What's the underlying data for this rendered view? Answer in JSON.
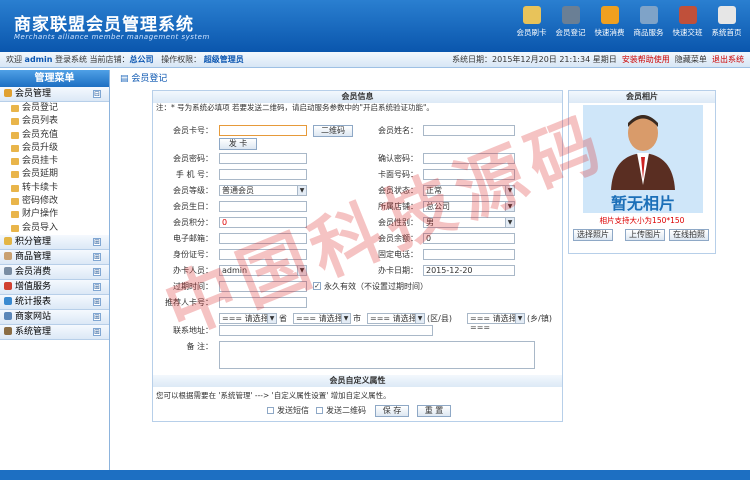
{
  "app": {
    "title": "商家联盟会员管理系统",
    "subtitle": "Merchants alliance member management system"
  },
  "topnav": [
    {
      "label": "会员刷卡",
      "icon": "card-icon",
      "color": "#e8c35a"
    },
    {
      "label": "会员登记",
      "icon": "user-icon",
      "color": "#6a7f95"
    },
    {
      "label": "快速消费",
      "icon": "cart-icon",
      "color": "#f0a020"
    },
    {
      "label": "商品服务",
      "icon": "doc-icon",
      "color": "#7fa3c8"
    },
    {
      "label": "快速交班",
      "icon": "users-icon",
      "color": "#c0503a"
    },
    {
      "label": "系统首页",
      "icon": "home-icon",
      "color": "#e6e6e6"
    }
  ],
  "infobar": {
    "welcome": "欢迎",
    "user": "admin",
    "login_sys": "登录系统",
    "store_label": "当前店铺：",
    "store": "总公司",
    "perm_label": "操作权限：",
    "perm": "超级管理员",
    "date": "系统日期：2015年12月20日 21:1:34 星期日",
    "links": [
      "安装帮助使用",
      "隐藏菜单",
      "退出系统"
    ]
  },
  "sidebar": {
    "title": "管理菜单",
    "groups": [
      {
        "label": "会员管理",
        "toggle": "⊟",
        "color": "#e0a030",
        "items": [
          "会员登记",
          "会员列表",
          "会员充值",
          "会员升级",
          "会员挂卡",
          "会员延期",
          "转卡续卡",
          "密码修改",
          "财户操作",
          "会员导入"
        ]
      },
      {
        "label": "积分管理",
        "toggle": "⊞",
        "color": "#e3b545"
      },
      {
        "label": "商品管理",
        "toggle": "⊞",
        "color": "#c9a070"
      },
      {
        "label": "会员消费",
        "toggle": "⊞",
        "color": "#7a8da3"
      },
      {
        "label": "增值服务",
        "toggle": "⊞",
        "color": "#d04030"
      },
      {
        "label": "统计报表",
        "toggle": "⊞",
        "color": "#3a8ad0"
      },
      {
        "label": "商家网站",
        "toggle": "⊞",
        "color": "#5a86b8"
      },
      {
        "label": "系统管理",
        "toggle": "⊞",
        "color": "#8a6d45"
      }
    ]
  },
  "main": {
    "crumb": "会员登记",
    "form_title": "会员信息",
    "note": "注：* 号为系统必填项  若要发送二维码，请启动服务参数中的\"开启系统验证功能\"。",
    "fields": {
      "card_no": "会员卡号：",
      "card_name": "会员姓名：",
      "pwd": "会员密码：",
      "confirm_pwd": "确认密码：",
      "mobile": "手 机 号：",
      "tel_no": "卡面号码：",
      "level": "会员等级：",
      "status": "会员状态：",
      "birthday": "会员生日：",
      "store": "所属店铺：",
      "points": "会员积分：",
      "gender": "会员性别：",
      "email": "电子邮箱：",
      "balance": "会员余额：",
      "idcard": "身份证号：",
      "phone": "固定电话：",
      "handler": "办卡人员：",
      "card_date": "办卡日期：",
      "expire": "过期时间：",
      "referrer": "推荐人卡号：",
      "address": "联系地址：",
      "remark": "备   注："
    },
    "values": {
      "level": "普通会员",
      "status": "正常",
      "store": "总公司",
      "points": "0",
      "gender": "男",
      "balance": "0",
      "handler": "admin",
      "card_date": "2015-12-20",
      "forever": "永久有效（不设置过期时间）",
      "addr1": "=== 请选择 ===",
      "addr1_suffix": "省",
      "addr2": "=== 请选择 ===",
      "addr2_suffix": "市",
      "addr3": "=== 请选择 ===",
      "addr3_suffix": "(区/县)",
      "addr4": "=== 请选择 ===",
      "addr4_suffix": "(乡/镇)"
    },
    "buttons": {
      "qr": "二维码",
      "send": "发 卡",
      "save": "保 存",
      "reset": "重 置"
    },
    "custom_title": "会员自定义属性",
    "custom_note": "您可以根据需要在 '系统管理' ---> '自定义属性设置' 增加自定义属性。",
    "chk_sms": "发送短信",
    "chk_qr": "发送二维码",
    "photo": {
      "title": "会员相片",
      "placeholder": "暂无相片",
      "tip": "相片支持大小为150*150",
      "btn_select": "选择照片",
      "btn_upload": "上传图片",
      "btn_camera": "在线拍照"
    }
  },
  "watermark": "中国科技源码"
}
